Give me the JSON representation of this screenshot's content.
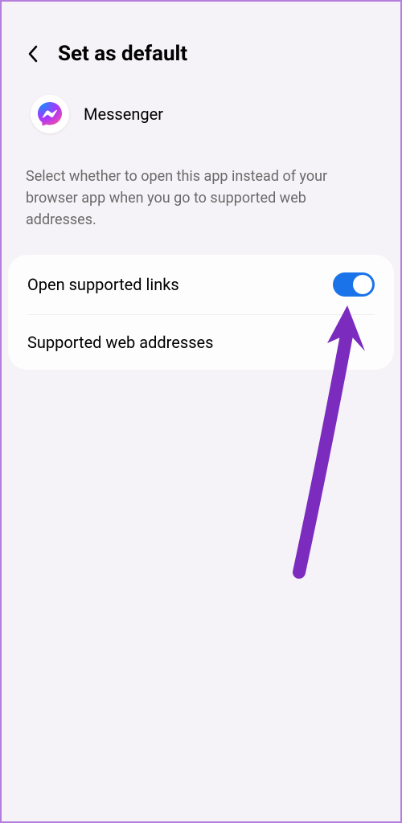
{
  "header": {
    "title": "Set as default"
  },
  "app": {
    "name": "Messenger"
  },
  "description": "Select whether to open this app instead of your browser app when you go to supported web addresses.",
  "settings": {
    "open_supported_links": {
      "label": "Open supported links",
      "enabled": true
    },
    "supported_web_addresses": {
      "label": "Supported web addresses"
    }
  },
  "colors": {
    "toggle_on": "#1a73e8",
    "annotation": "#7b2cbf",
    "border": "#b57edc"
  }
}
